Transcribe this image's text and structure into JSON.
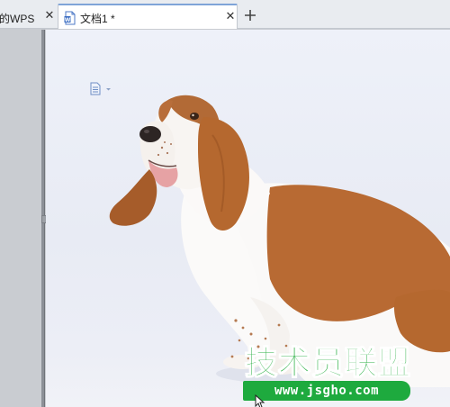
{
  "tabs": [
    {
      "label": "的WPS",
      "close": "✕",
      "active": false
    },
    {
      "label": "文档1 *",
      "close": "✕",
      "active": true
    }
  ],
  "add_tab_icon": "plus-icon",
  "colors": {
    "tab_accent": "#7fa4d8",
    "page_background": "#eceff7",
    "watermark_green": "#32b24a",
    "dog_brown": "#b5682f"
  },
  "document": {
    "image_subject": "basset-hound-photo",
    "watermark_title": "技术员联盟",
    "watermark_url": "www.jsgho.com"
  }
}
